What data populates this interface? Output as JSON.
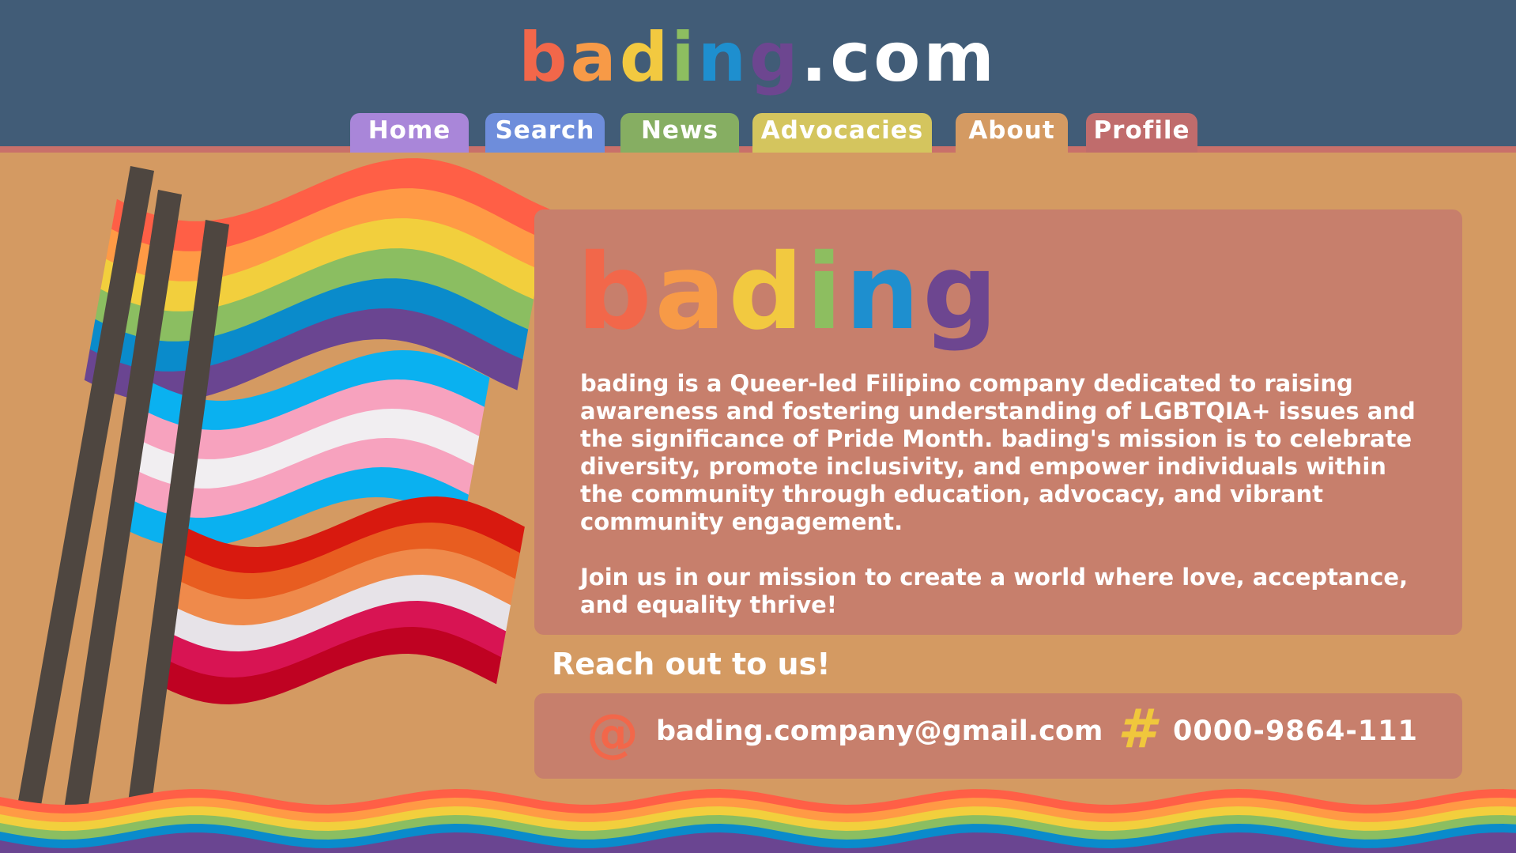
{
  "logo": {
    "letters": [
      {
        "ch": "b",
        "color": "#F2674A"
      },
      {
        "ch": "a",
        "color": "#F79A47"
      },
      {
        "ch": "d",
        "color": "#F2C940"
      },
      {
        "ch": "i",
        "color": "#8DBE60"
      },
      {
        "ch": "n",
        "color": "#1E8FCF"
      },
      {
        "ch": "g",
        "color": "#6D4690"
      }
    ],
    "suffix": ".com",
    "suffix_color": "#ffffff"
  },
  "nav": {
    "tabs": [
      {
        "label": "Home",
        "color": "#A986D9"
      },
      {
        "label": "Search",
        "color": "#6E8DDB"
      },
      {
        "label": "News",
        "color": "#86AE62"
      },
      {
        "label": "Advocacies",
        "color": "#D4C55E"
      },
      {
        "label": "About",
        "color": "#D49A62",
        "active": true
      },
      {
        "label": "Profile",
        "color": "#C06C6C"
      }
    ]
  },
  "about": {
    "paragraph1": "bading is a Queer-led Filipino company dedicated to raising awareness and fostering understanding of LGBTQIA+ issues and the significance of Pride Month. bading's mission is to celebrate diversity, promote inclusivity, and empower individuals within the community through education, advocacy, and vibrant community engagement.",
    "paragraph2": "Join us in our mission to create a world where love, acceptance, and equality thrive!"
  },
  "contact": {
    "title": "Reach out to us!",
    "email_icon": "at-icon",
    "email": "bading.company@gmail.com",
    "phone_icon": "hash-icon",
    "phone": "0000-9864-111"
  },
  "colors": {
    "header_bg": "#415C77",
    "page_bg": "#D49A62",
    "card_bg": "#C77F6C",
    "pole": "#4E4640"
  },
  "flags": [
    "rainbow-pride-flag",
    "transgender-flag",
    "lesbian-flag"
  ]
}
